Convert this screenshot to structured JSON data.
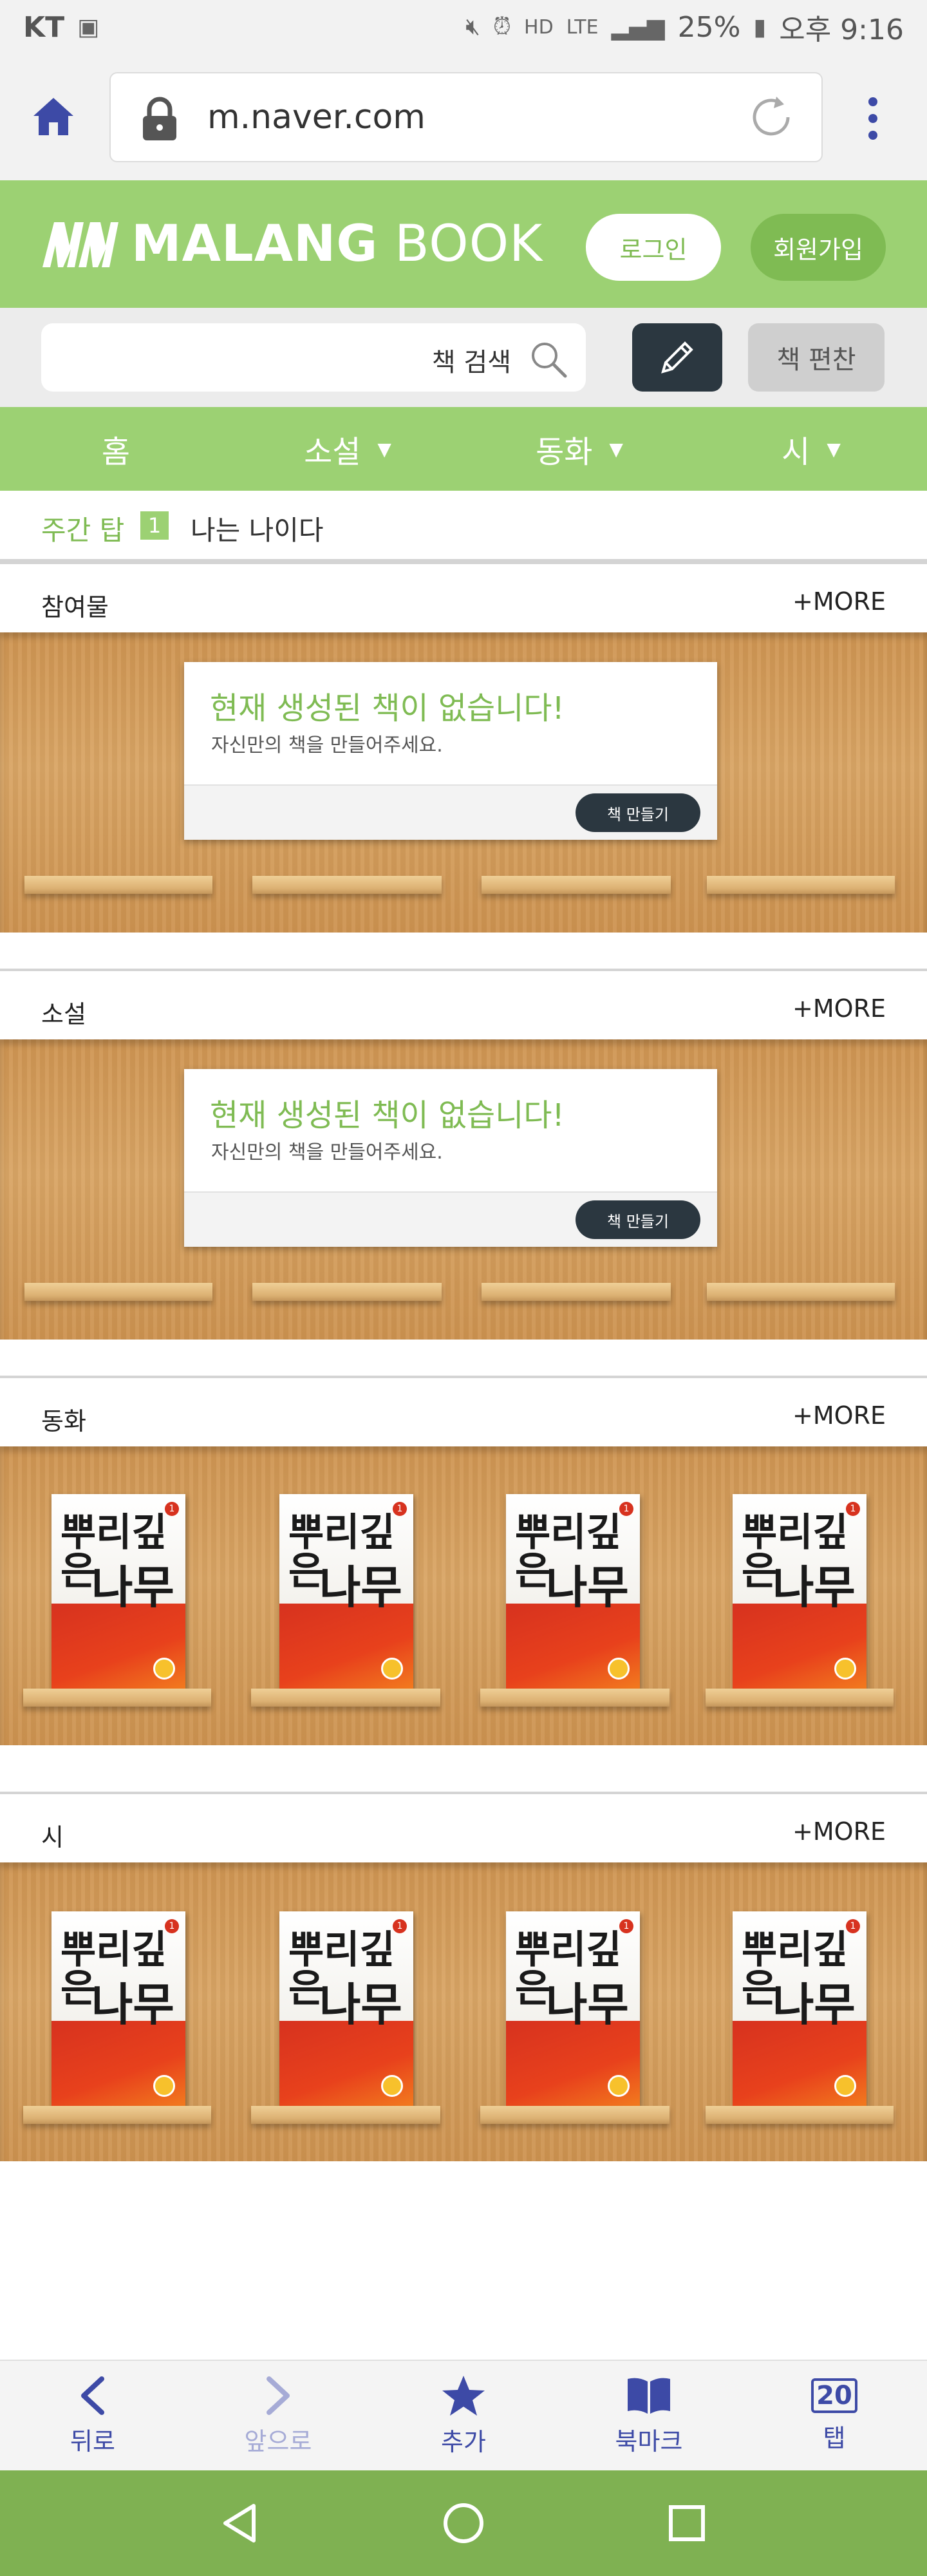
{
  "status_bar": {
    "carrier": "KT",
    "battery": "25%",
    "time": "오후 9:16",
    "network": "LTE",
    "hd_label": "HD"
  },
  "browser": {
    "url": "m.naver.com"
  },
  "header": {
    "logo_bold": "MALANG",
    "logo_light": "BOOK",
    "login_label": "로그인",
    "signup_label": "회원가입"
  },
  "search": {
    "label": "책 검색",
    "compile_label": "책 편찬"
  },
  "nav": {
    "items": [
      {
        "label": "홈",
        "has_dropdown": false
      },
      {
        "label": "소설",
        "has_dropdown": true
      },
      {
        "label": "동화",
        "has_dropdown": true
      },
      {
        "label": "시",
        "has_dropdown": true
      }
    ]
  },
  "weekly_top": {
    "label": "주간 탑",
    "rank": "1",
    "title": "나는 나이다"
  },
  "more_label": "+MORE",
  "sections": [
    {
      "title": "참여물",
      "empty": true
    },
    {
      "title": "소설",
      "empty": true
    },
    {
      "title": "동화",
      "empty": false,
      "book_count": 4
    },
    {
      "title": "시",
      "empty": false,
      "book_count": 4
    }
  ],
  "empty_state": {
    "title": "현재 생성된 책이 없습니다!",
    "subtitle": "자신만의 책을 만들어주세요.",
    "button": "책 만들기"
  },
  "book_cover": {
    "title_line1": "뿌리깊은",
    "title_line2": "나무",
    "number": "1"
  },
  "toolbar": {
    "back": "뒤로",
    "forward": "앞으로",
    "add": "추가",
    "bookmark": "북마크",
    "tabs": "탭",
    "tab_count": "20"
  },
  "colors": {
    "brand_green": "#9cd173",
    "dark_button": "#2b3740",
    "toolbar_blue": "#3d4aa6",
    "android_nav": "#7fb152"
  }
}
